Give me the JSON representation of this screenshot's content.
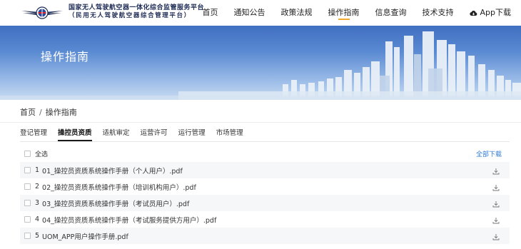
{
  "header": {
    "title_line1": "国家无人驾驶航空器一体化综合监管服务平台",
    "title_line2": "（民用无人驾驶航空器综合管理平台）",
    "nav": [
      {
        "label": "首页",
        "active": false
      },
      {
        "label": "通知公告",
        "active": false
      },
      {
        "label": "政策法规",
        "active": false
      },
      {
        "label": "操作指南",
        "active": true
      },
      {
        "label": "信息查询",
        "active": false
      },
      {
        "label": "技术支持",
        "active": false
      }
    ],
    "app_label": "App下载"
  },
  "banner": {
    "title": "操作指南"
  },
  "breadcrumb": {
    "home": "首页",
    "separator": "/",
    "current": "操作指南"
  },
  "tabs": [
    {
      "label": "登记管理",
      "active": false
    },
    {
      "label": "操控员资质",
      "active": true
    },
    {
      "label": "适航审定",
      "active": false
    },
    {
      "label": "运营许可",
      "active": false
    },
    {
      "label": "运行管理",
      "active": false
    },
    {
      "label": "市场管理",
      "active": false
    }
  ],
  "select_all_label": "全选",
  "download_all_label": "全部下载",
  "files": [
    {
      "num": "1",
      "name": "01_操控员资质系统操作手册（个人用户）.pdf"
    },
    {
      "num": "2",
      "name": "02_操控员资质系统操作手册（培训机构用户）.pdf"
    },
    {
      "num": "3",
      "name": "03_操控员资质系统操作手册（考试员用户）.pdf"
    },
    {
      "num": "4",
      "name": "04_操控员资质系统操作手册（考试服务提供方用户）.pdf"
    },
    {
      "num": "5",
      "name": "UOM_APP用户操作手册.pdf"
    }
  ],
  "colors": {
    "accent": "#f0a830",
    "link": "#2e7ad6",
    "brand": "#1e2c55"
  }
}
